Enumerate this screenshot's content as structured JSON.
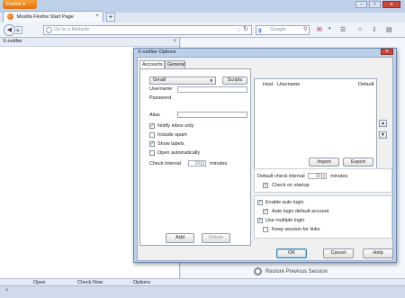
{
  "browser": {
    "menu_button": "Firefox ▾",
    "tab_title": "Mozilla Firefox Start Page",
    "url_placeholder": "Go to a Website",
    "search_engine": "g",
    "search_placeholder": "Google",
    "window_controls": [
      "–",
      "□",
      "✕"
    ]
  },
  "sidebar": {
    "title": "X-notifier",
    "footer": [
      "Open",
      "Check Now",
      "Options"
    ]
  },
  "content": {
    "restore_label": "Restore Previous Session"
  },
  "dialog": {
    "title": "X-notifier Options",
    "tabs": [
      "Accounts",
      "General"
    ],
    "account_type": "Gmail",
    "scripts_label": "Scripts",
    "username_label": "Username",
    "username_value": "",
    "password_label": "Password",
    "alias_label": "Alias",
    "checkboxes": [
      {
        "label": "Notify inbox only",
        "checked": true
      },
      {
        "label": "Include spam",
        "checked": false
      },
      {
        "label": "Show labels",
        "checked": true
      },
      {
        "label": "Open automatically",
        "checked": false
      }
    ],
    "check_interval_label": "Check interval",
    "check_interval_value": "10",
    "minutes_label": "minutes",
    "add_label": "Add",
    "delete_label": "Delete",
    "list_columns": [
      "Host",
      "Username",
      "Default"
    ],
    "move_up": "▲",
    "move_down": "▼",
    "import_label": "Import",
    "export_label": "Export",
    "default_interval_label": "Default check interval",
    "default_interval_value": "10",
    "default_minutes_label": "minutes",
    "check_on_startup": {
      "label": "Check on startup",
      "checked": true
    },
    "login_options": [
      {
        "label": "Enable auto login",
        "checked": true
      },
      {
        "label": "Auto login default account",
        "checked": true
      },
      {
        "label": "Use multiple login",
        "checked": true
      },
      {
        "label": "Keep session for links",
        "checked": false
      }
    ],
    "ok_label": "OK",
    "cancel_label": "Cancel",
    "help_label": "Help"
  }
}
